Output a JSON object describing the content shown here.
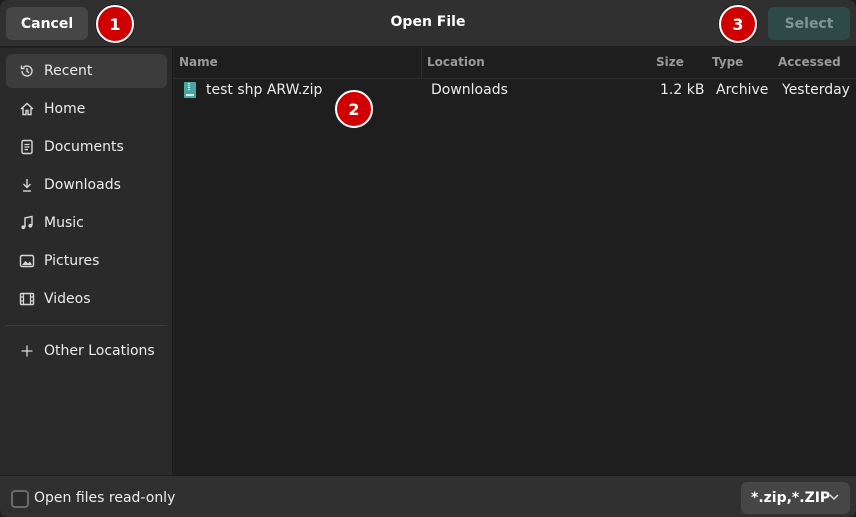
{
  "header": {
    "cancel_label": "Cancel",
    "title": "Open File",
    "select_label": "Select"
  },
  "markers": [
    "1",
    "2",
    "3"
  ],
  "sidebar": {
    "items": [
      {
        "label": "Recent",
        "icon": "clock-icon",
        "active": true
      },
      {
        "label": "Home",
        "icon": "home-icon"
      },
      {
        "label": "Documents",
        "icon": "document-icon"
      },
      {
        "label": "Downloads",
        "icon": "download-icon"
      },
      {
        "label": "Music",
        "icon": "music-note-icon"
      },
      {
        "label": "Pictures",
        "icon": "picture-icon"
      },
      {
        "label": "Videos",
        "icon": "film-icon"
      }
    ],
    "other_locations": {
      "label": "Other Locations",
      "icon": "plus-icon"
    }
  },
  "file_list": {
    "columns": [
      "Name",
      "Location",
      "Size",
      "Type",
      "Accessed"
    ],
    "rows": [
      {
        "name": "test shp ARW.zip",
        "location": "Downloads",
        "size": "1.2 kB",
        "type": "Archive",
        "accessed": "Yesterday",
        "icon": "zip-archive-icon"
      }
    ]
  },
  "footer": {
    "read_only_label": "Open files read-only",
    "read_only_checked": false,
    "filter_value": "*.zip,*.ZIP"
  },
  "colors": {
    "accent_disabled": "#2d4a48",
    "marker_red": "#d10000"
  }
}
